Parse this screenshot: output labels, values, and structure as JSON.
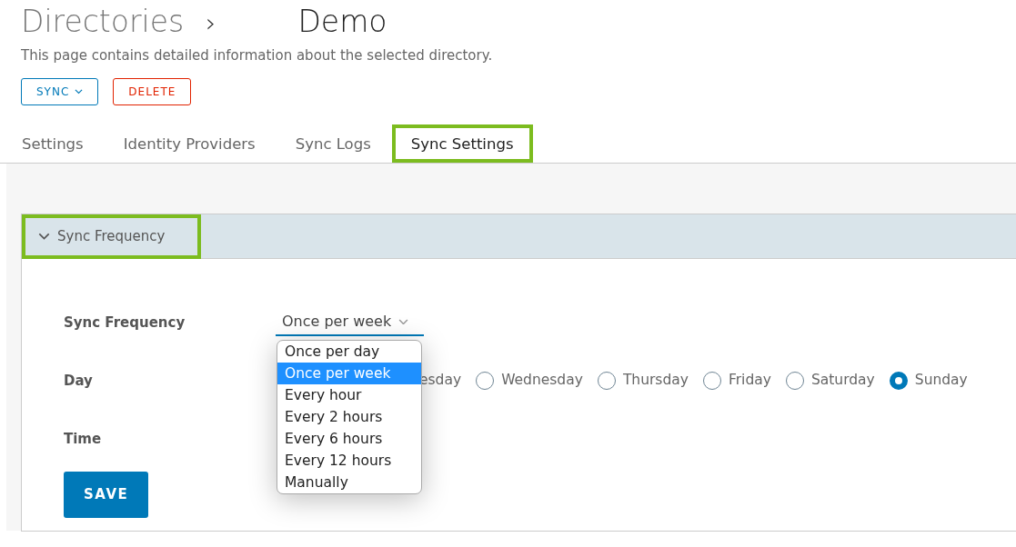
{
  "breadcrumb": {
    "parent": "Directories",
    "separator": "›",
    "current": "Demo"
  },
  "description": "This page contains detailed information about the selected directory.",
  "actions": [
    {
      "label": "SYNC",
      "kind": "dropdown"
    },
    {
      "label": "DELETE",
      "kind": "danger"
    }
  ],
  "tabs": [
    {
      "label": "Settings",
      "selected": false,
      "highlighted": false
    },
    {
      "label": "Identity Providers",
      "selected": false,
      "highlighted": false
    },
    {
      "label": "Sync Logs",
      "selected": false,
      "highlighted": false
    },
    {
      "label": "Sync Settings",
      "selected": true,
      "highlighted": true
    }
  ],
  "section": {
    "title": "Sync Frequency",
    "expanded": true,
    "highlighted": true
  },
  "form": {
    "frequency": {
      "label": "Sync Frequency",
      "value": "Once per week",
      "expanded": true,
      "options": [
        {
          "label": "Once per day",
          "selected": false
        },
        {
          "label": "Once per week",
          "selected": true
        },
        {
          "label": "Every hour",
          "selected": false
        },
        {
          "label": "Every 2 hours",
          "selected": false
        },
        {
          "label": "Every 6 hours",
          "selected": false
        },
        {
          "label": "Every 12 hours",
          "selected": false
        },
        {
          "label": "Manually",
          "selected": false
        }
      ]
    },
    "day": {
      "label": "Day",
      "partial_option": "esday",
      "options": [
        {
          "label": "Wednesday",
          "selected": false
        },
        {
          "label": "Thursday",
          "selected": false
        },
        {
          "label": "Friday",
          "selected": false
        },
        {
          "label": "Saturday",
          "selected": false
        },
        {
          "label": "Sunday",
          "selected": true
        }
      ]
    },
    "time": {
      "label": "Time"
    },
    "save": "SAVE"
  }
}
